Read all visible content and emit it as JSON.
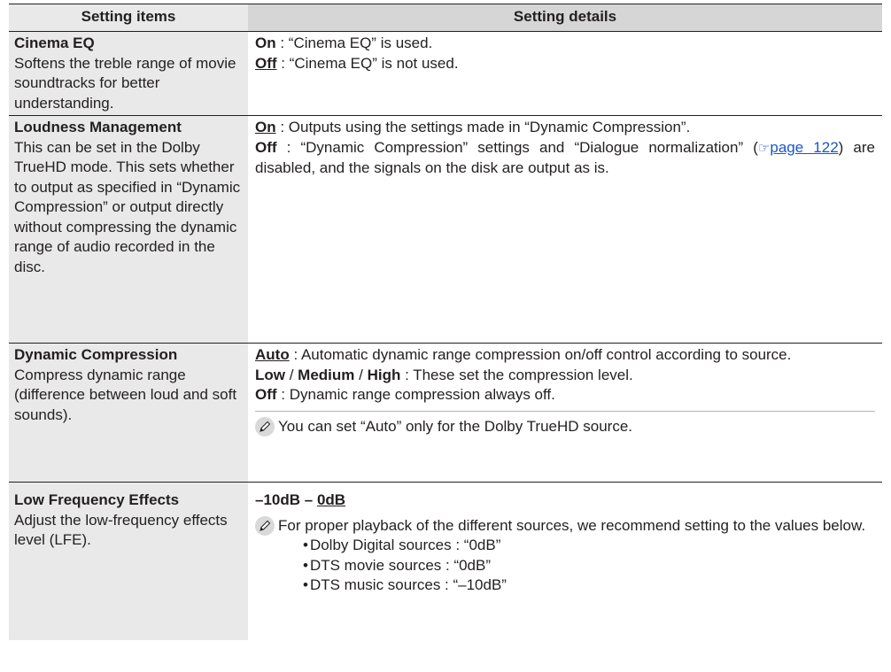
{
  "header": {
    "col1": "Setting items",
    "col2": "Setting details"
  },
  "rows": [
    {
      "name": "Cinema EQ",
      "desc": "Softens the treble range of movie soundtracks for better understanding.",
      "opt1_key": "On",
      "opt1_text": " : “Cinema EQ” is used.",
      "opt2_key": "Off",
      "opt2_text": " : “Cinema EQ” is not used."
    },
    {
      "name": "Loudness Management",
      "desc": "This can be set in the Dolby TrueHD mode. This sets whether to output as specified in “Dynamic Compression” or output directly without compressing the dynamic range of audio recorded in the disc.",
      "opt1_key": "On",
      "opt1_text": " : Outputs using the settings made in “Dynamic Compression”.",
      "opt2_key": "Off",
      "opt2_text": " : “Dynamic Compression” settings and “Dialogue normalization” (",
      "opt2_link": "page 122",
      "opt2_tail": ") are disabled, and the signals on the disk are output as is."
    },
    {
      "name": "Dynamic Compression",
      "desc": "Compress dynamic range (difference between loud and soft sounds).",
      "opt1_key": "Auto",
      "opt1_text": " : Automatic dynamic range compression on/off control according to source.",
      "opt2_key_a": "Low",
      "opt2_sep1": " / ",
      "opt2_key_b": "Medium",
      "opt2_sep2": " / ",
      "opt2_key_c": "High",
      "opt2_text": " : These set the compression level.",
      "opt3_key": "Off",
      "opt3_text": " : Dynamic range compression always off.",
      "note": "You can set “Auto” only for the Dolby TrueHD source."
    },
    {
      "name": "Low Frequency Effects",
      "desc": "Adjust the low-frequency effects level (LFE).",
      "range_a": "–10dB – ",
      "range_b": "0dB",
      "note": "For proper playback of the different sources, we recommend setting to the values below.",
      "bullets": [
        "Dolby Digital sources : “0dB”",
        "DTS movie sources : “0dB”",
        "DTS music sources : “–10dB”"
      ]
    }
  ]
}
